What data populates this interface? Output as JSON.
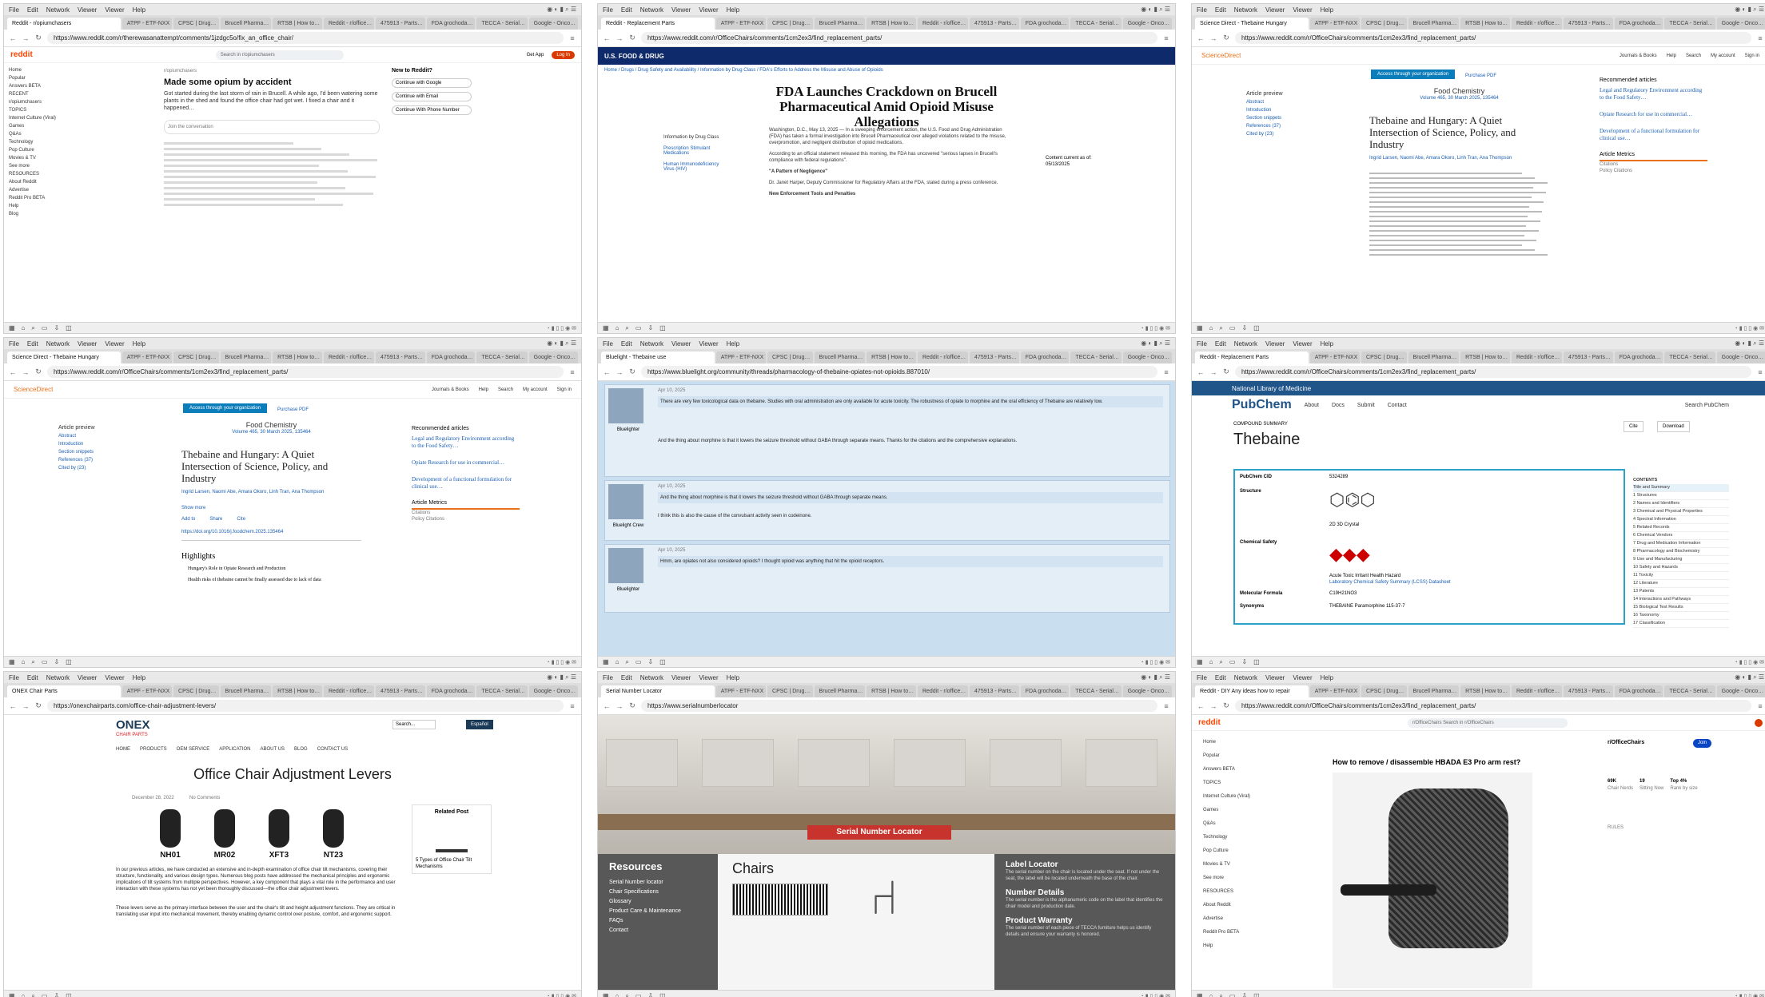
{
  "browser": {
    "menu": [
      "File",
      "Edit",
      "Network",
      "Viewer",
      "Viewer",
      "Help"
    ],
    "bg_tabs": [
      "ATPF - ETF-NXX",
      "CPSC | Drug…",
      "Brucell Pharma…",
      "RTSB | How to…",
      "Reddit - r/office…",
      "475913 - Parts…",
      "FDA grochoda…",
      "TECCA - Serial…",
      "Google - Onco…"
    ]
  },
  "panels": [
    {
      "tab": "Reddit - r/opiumchasers",
      "url": "https://www.reddit.com/r/therewasanattempt/comments/1jzdgc5o/fix_an_office_chair/",
      "logo": "reddit",
      "search": "Search in r/opiumchasers",
      "login": "Log In",
      "getapp": "Get App",
      "sidebar": [
        "Home",
        "Popular",
        "Answers BETA",
        "RECENT",
        "r/opiumchasers",
        "TOPICS",
        "Internet Culture (Viral)",
        "Games",
        "Q&As",
        "Technology",
        "Pop Culture",
        "Movies & TV",
        "See more",
        "RESOURCES",
        "About Reddit",
        "Advertise",
        "Reddit Pro BETA",
        "Help",
        "Blog"
      ],
      "post_user": "r/opiumchasers",
      "post_title": "Made some opium by accident",
      "post_body": "Got started during the last storm of rain in Brucell. A while ago, I'd been watering some plants in the shed and found the office chair had got wet. I fixed a chair and it happened…",
      "comment_placeholder": "Join the conversation",
      "right_title": "New to Reddit?",
      "right_items": [
        "Continue with Google",
        "Continue with Email",
        "Continue With Phone Number"
      ]
    },
    {
      "tab": "Reddit - Replacement Parts",
      "url": "https://www.reddit.com/r/OfficeChairs/comments/1cm2ex3/find_replacement_parts/",
      "agency": "U.S. FOOD & DRUG",
      "breadcrumb": "Home / Drugs / Drug Safety and Availability / Information by Drug Class / FDA's Efforts to Address the Misuse and Abuse of Opioids",
      "title": "FDA Launches Crackdown on Brucell Pharmaceutical Amid Opioid Misuse Allegations",
      "side_label": "Information by Drug Class",
      "side_links": [
        "Prescription Stimulant Medications",
        "Human Immunodeficiency Virus (HIV)"
      ],
      "body": [
        "Washington, D.C., May 13, 2025 — In a sweeping enforcement action, the U.S. Food and Drug Administration (FDA) has taken a formal investigation into Brucell Pharmaceutical over alleged violations related to the misuse, overpromotion, and negligent distribution of opioid medications.",
        "According to an official statement released this morning, the FDA has uncovered \"serious lapses in Brucell's compliance with federal regulations\".",
        "\"A Pattern of Negligence\"",
        "Dr. Janet Harper, Deputy Commissioner for Regulatory Affairs at the FDA, stated during a press conference.",
        "New Enforcement Tools and Penalties"
      ],
      "date_label": "Content current as of:",
      "date": "05/13/2025"
    },
    {
      "tab": "Science Direct - Thebaine Hungary",
      "url": "https://www.reddit.com/r/OfficeChairs/comments/1cm2ex3/find_replacement_parts/",
      "logo": "ScienceDirect",
      "nav": [
        "Journals & Books",
        "Help",
        "Search",
        "My account",
        "Sign in"
      ],
      "access": "Access through your organization",
      "purchase": "Purchase PDF",
      "outline_title": "Article preview",
      "outline": [
        "Abstract",
        "Introduction",
        "Section snippets",
        "References (37)",
        "Cited by (23)"
      ],
      "journal": "Food Chemistry",
      "volume": "Volume 465, 30 March 2025, 135464",
      "article_title": "Thebaine and Hungary: A Quiet Intersection of Science, Policy, and Industry",
      "authors": "Ingrid Larsen, Naomi Abe, Amara Okoro, Linh Tran, Ana Thompson",
      "rec_title": "Recommended articles",
      "recs": [
        "Legal and Regulatory Environment according to the Food Safety…",
        "Opiate Research for use in commercial…",
        "Development of a functional formulation for clinical use…"
      ],
      "metrics_title": "Article Metrics",
      "metrics": [
        "Citations",
        "Policy Citations"
      ]
    },
    {
      "tab": "Science Direct - Thebaine Hungary",
      "url": "https://www.reddit.com/r/OfficeChairs/comments/1cm2ex3/find_replacement_parts/",
      "highlights": "Highlights",
      "highlight_items": [
        "Hungary's Role in Opiate Research and Production",
        "Health risks of thebaine cannot be finally assessed due to lack of data"
      ],
      "actions": [
        "Add to",
        "Share",
        "Cite"
      ],
      "show_more": "Show more",
      "doi": "https://doi.org/10.1016/j.foodchem.2025.135464"
    },
    {
      "tab": "Bluelight - Thebaine use",
      "url": "https://www.bluelight.org/community/threads/pharmacology-of-thebaine-opiates-not-opioids.887010/",
      "posts": [
        {
          "user": "Bluelighter",
          "date": "Apr 10, 2025",
          "text": "There are very few toxicological data on thebaine. Studies with oral administration are only available for acute toxicity. The robustness of opiate to morphine and the oral efficiency of Thebaine are relatively low.",
          "reply": "And the thing about morphine is that it lowers the seizure threshold without GABA through separate means. Thanks for the citations and the comprehensive explanations."
        },
        {
          "user": "Bluelight Crew",
          "date": "Apr 10, 2025",
          "text": "And the thing about morphine is that it lowers the seizure threshold without GABA through separate means.",
          "reply": "I think this is also the cause of the convulsant activity seen in codeinone."
        },
        {
          "user": "Bluelighter",
          "date": "Apr 10, 2025",
          "text": "Hmm, are opiates not also considered opioids? I thought opioid was anything that hit the opioid receptors.",
          "reply": ""
        }
      ]
    },
    {
      "tab": "Reddit - Replacement Parts",
      "url": "https://www.reddit.com/r/OfficeChairs/comments/1cm2ex3/find_replacement_parts/",
      "nih": "National Library of Medicine",
      "logo": "PubChem",
      "nav": [
        "About",
        "Docs",
        "Submit",
        "Contact"
      ],
      "search": "Search PubChem",
      "summary_label": "COMPOUND SUMMARY",
      "compound": "Thebaine",
      "cite": "Cite",
      "download": "Download",
      "fields": [
        {
          "k": "PubChem CID",
          "v": "5324289"
        },
        {
          "k": "Structure",
          "v": "2D   3D   Crystal"
        },
        {
          "k": "Chemical Safety",
          "v": "Acute Toxic   Irritant   Health Hazard"
        },
        {
          "k": "Molecular Formula",
          "v": "C19H21NO3"
        },
        {
          "k": "Synonyms",
          "v": "THEBAINE  Paramorphine  115-37-7"
        }
      ],
      "lcss": "Laboratory Chemical Safety Summary (LCSS) Datasheet",
      "toc_title": "CONTENTS",
      "toc": [
        "Title and Summary",
        "1 Structures",
        "2 Names and Identifiers",
        "3 Chemical and Physical Properties",
        "4 Spectral Information",
        "5 Related Records",
        "6 Chemical Vendors",
        "7 Drug and Medication Information",
        "8 Pharmacology and Biochemistry",
        "9 Use and Manufacturing",
        "10 Safety and Hazards",
        "11 Toxicity",
        "12 Literature",
        "13 Patents",
        "14 Interactions and Pathways",
        "15 Biological Test Results",
        "16 Taxonomy",
        "17 Classification"
      ]
    },
    {
      "tab": "ONEX Chair Parts",
      "url": "https://onexchairparts.com/office-chair-adjustment-levers/",
      "logo": "ONEX",
      "logo_sub": "CHAIR PARTS",
      "nav": [
        "HOME",
        "PRODUCTS",
        "OEM SERVICE",
        "APPLICATION",
        "ABOUT US",
        "BLOG",
        "CONTACT US"
      ],
      "search": "Search...",
      "lang": "Español",
      "title": "Office Chair Adjustment Levers",
      "date": "December 28, 2022",
      "comments": "No Comments",
      "levers": [
        "NH01",
        "MR02",
        "XFT3",
        "NT23"
      ],
      "related": "Related Post",
      "related_item": "5 Types of Office Chair Tilt Mechanisms",
      "body1": "In our previous articles, we have conducted an extensive and in-depth examination of office chair tilt mechanisms, covering their structure, functionality, and various design types. Numerous blog posts have addressed the mechanical principles and ergonomic implications of tilt systems from multiple perspectives. However, a key component that plays a vital role in the performance and user interaction with these systems has not yet been thoroughly discussed—the office chair adjustment levers.",
      "body2": "These levers serve as the primary interface between the user and the chair's tilt and height adjustment functions. They are critical in translating user input into mechanical movement, thereby enabling dynamic control over posture, comfort, and ergonomic support."
    },
    {
      "tab": "Serial Number Locator",
      "url": "https://www.serialnumberlocator",
      "banner": "Serial Number Locator",
      "resources_title": "Resources",
      "resources": [
        "Serial Number locator",
        "Chair Specifications",
        "Glossary",
        "Product Care & Maintenance",
        "FAQs",
        "Contact"
      ],
      "chairs_title": "Chairs",
      "info": [
        {
          "h": "Label Locator",
          "t": "The serial number on the chair is located under the seat. If not under the seat, the label will be located underneath the base of the chair."
        },
        {
          "h": "Number Details",
          "t": "The serial number is the alphanumeric code on the label that identifies the chair model and production date."
        },
        {
          "h": "Product Warranty",
          "t": "The serial number of each piece of TECCA furniture helps us identify details and ensure your warranty is honored."
        }
      ]
    },
    {
      "tab": "Reddit - DIY Any ideas how to repair",
      "url": "https://www.reddit.com/r/OfficeChairs/comments/1cm2ex3/find_replacement_parts/",
      "search": "r/OfficeChairs  Search in r/OfficeChairs",
      "sidebar": [
        "Home",
        "Popular",
        "Answers BETA",
        "TOPICS",
        "Internet Culture (Viral)",
        "Games",
        "Q&As",
        "Technology",
        "Pop Culture",
        "Movies & TV",
        "See more",
        "RESOURCES",
        "About Reddit",
        "Advertise",
        "Reddit Pro BETA",
        "Help"
      ],
      "post_title": "How to remove / disassemble HBADA E3 Pro arm rest?",
      "community": "r/OfficeChairs",
      "join": "Join",
      "stats": [
        {
          "n": "69K",
          "l": "Chair Nerds"
        },
        {
          "n": "19",
          "l": "Sitting Now"
        },
        {
          "n": "Top 4%",
          "l": "Rank by size"
        }
      ],
      "rules": "RULES"
    }
  ]
}
